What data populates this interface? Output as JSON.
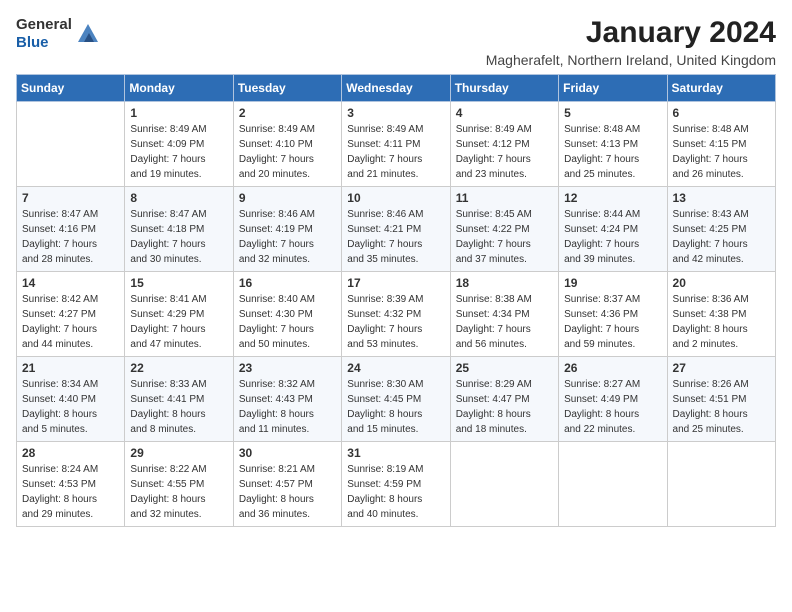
{
  "header": {
    "logo_line1": "General",
    "logo_line2": "Blue",
    "month_title": "January 2024",
    "location": "Magherafelt, Northern Ireland, United Kingdom"
  },
  "days_of_week": [
    "Sunday",
    "Monday",
    "Tuesday",
    "Wednesday",
    "Thursday",
    "Friday",
    "Saturday"
  ],
  "weeks": [
    [
      {
        "day": null,
        "info": null
      },
      {
        "day": "1",
        "info": "Sunrise: 8:49 AM\nSunset: 4:09 PM\nDaylight: 7 hours\nand 19 minutes."
      },
      {
        "day": "2",
        "info": "Sunrise: 8:49 AM\nSunset: 4:10 PM\nDaylight: 7 hours\nand 20 minutes."
      },
      {
        "day": "3",
        "info": "Sunrise: 8:49 AM\nSunset: 4:11 PM\nDaylight: 7 hours\nand 21 minutes."
      },
      {
        "day": "4",
        "info": "Sunrise: 8:49 AM\nSunset: 4:12 PM\nDaylight: 7 hours\nand 23 minutes."
      },
      {
        "day": "5",
        "info": "Sunrise: 8:48 AM\nSunset: 4:13 PM\nDaylight: 7 hours\nand 25 minutes."
      },
      {
        "day": "6",
        "info": "Sunrise: 8:48 AM\nSunset: 4:15 PM\nDaylight: 7 hours\nand 26 minutes."
      }
    ],
    [
      {
        "day": "7",
        "info": "Sunrise: 8:47 AM\nSunset: 4:16 PM\nDaylight: 7 hours\nand 28 minutes."
      },
      {
        "day": "8",
        "info": "Sunrise: 8:47 AM\nSunset: 4:18 PM\nDaylight: 7 hours\nand 30 minutes."
      },
      {
        "day": "9",
        "info": "Sunrise: 8:46 AM\nSunset: 4:19 PM\nDaylight: 7 hours\nand 32 minutes."
      },
      {
        "day": "10",
        "info": "Sunrise: 8:46 AM\nSunset: 4:21 PM\nDaylight: 7 hours\nand 35 minutes."
      },
      {
        "day": "11",
        "info": "Sunrise: 8:45 AM\nSunset: 4:22 PM\nDaylight: 7 hours\nand 37 minutes."
      },
      {
        "day": "12",
        "info": "Sunrise: 8:44 AM\nSunset: 4:24 PM\nDaylight: 7 hours\nand 39 minutes."
      },
      {
        "day": "13",
        "info": "Sunrise: 8:43 AM\nSunset: 4:25 PM\nDaylight: 7 hours\nand 42 minutes."
      }
    ],
    [
      {
        "day": "14",
        "info": "Sunrise: 8:42 AM\nSunset: 4:27 PM\nDaylight: 7 hours\nand 44 minutes."
      },
      {
        "day": "15",
        "info": "Sunrise: 8:41 AM\nSunset: 4:29 PM\nDaylight: 7 hours\nand 47 minutes."
      },
      {
        "day": "16",
        "info": "Sunrise: 8:40 AM\nSunset: 4:30 PM\nDaylight: 7 hours\nand 50 minutes."
      },
      {
        "day": "17",
        "info": "Sunrise: 8:39 AM\nSunset: 4:32 PM\nDaylight: 7 hours\nand 53 minutes."
      },
      {
        "day": "18",
        "info": "Sunrise: 8:38 AM\nSunset: 4:34 PM\nDaylight: 7 hours\nand 56 minutes."
      },
      {
        "day": "19",
        "info": "Sunrise: 8:37 AM\nSunset: 4:36 PM\nDaylight: 7 hours\nand 59 minutes."
      },
      {
        "day": "20",
        "info": "Sunrise: 8:36 AM\nSunset: 4:38 PM\nDaylight: 8 hours\nand 2 minutes."
      }
    ],
    [
      {
        "day": "21",
        "info": "Sunrise: 8:34 AM\nSunset: 4:40 PM\nDaylight: 8 hours\nand 5 minutes."
      },
      {
        "day": "22",
        "info": "Sunrise: 8:33 AM\nSunset: 4:41 PM\nDaylight: 8 hours\nand 8 minutes."
      },
      {
        "day": "23",
        "info": "Sunrise: 8:32 AM\nSunset: 4:43 PM\nDaylight: 8 hours\nand 11 minutes."
      },
      {
        "day": "24",
        "info": "Sunrise: 8:30 AM\nSunset: 4:45 PM\nDaylight: 8 hours\nand 15 minutes."
      },
      {
        "day": "25",
        "info": "Sunrise: 8:29 AM\nSunset: 4:47 PM\nDaylight: 8 hours\nand 18 minutes."
      },
      {
        "day": "26",
        "info": "Sunrise: 8:27 AM\nSunset: 4:49 PM\nDaylight: 8 hours\nand 22 minutes."
      },
      {
        "day": "27",
        "info": "Sunrise: 8:26 AM\nSunset: 4:51 PM\nDaylight: 8 hours\nand 25 minutes."
      }
    ],
    [
      {
        "day": "28",
        "info": "Sunrise: 8:24 AM\nSunset: 4:53 PM\nDaylight: 8 hours\nand 29 minutes."
      },
      {
        "day": "29",
        "info": "Sunrise: 8:22 AM\nSunset: 4:55 PM\nDaylight: 8 hours\nand 32 minutes."
      },
      {
        "day": "30",
        "info": "Sunrise: 8:21 AM\nSunset: 4:57 PM\nDaylight: 8 hours\nand 36 minutes."
      },
      {
        "day": "31",
        "info": "Sunrise: 8:19 AM\nSunset: 4:59 PM\nDaylight: 8 hours\nand 40 minutes."
      },
      {
        "day": null,
        "info": null
      },
      {
        "day": null,
        "info": null
      },
      {
        "day": null,
        "info": null
      }
    ]
  ]
}
